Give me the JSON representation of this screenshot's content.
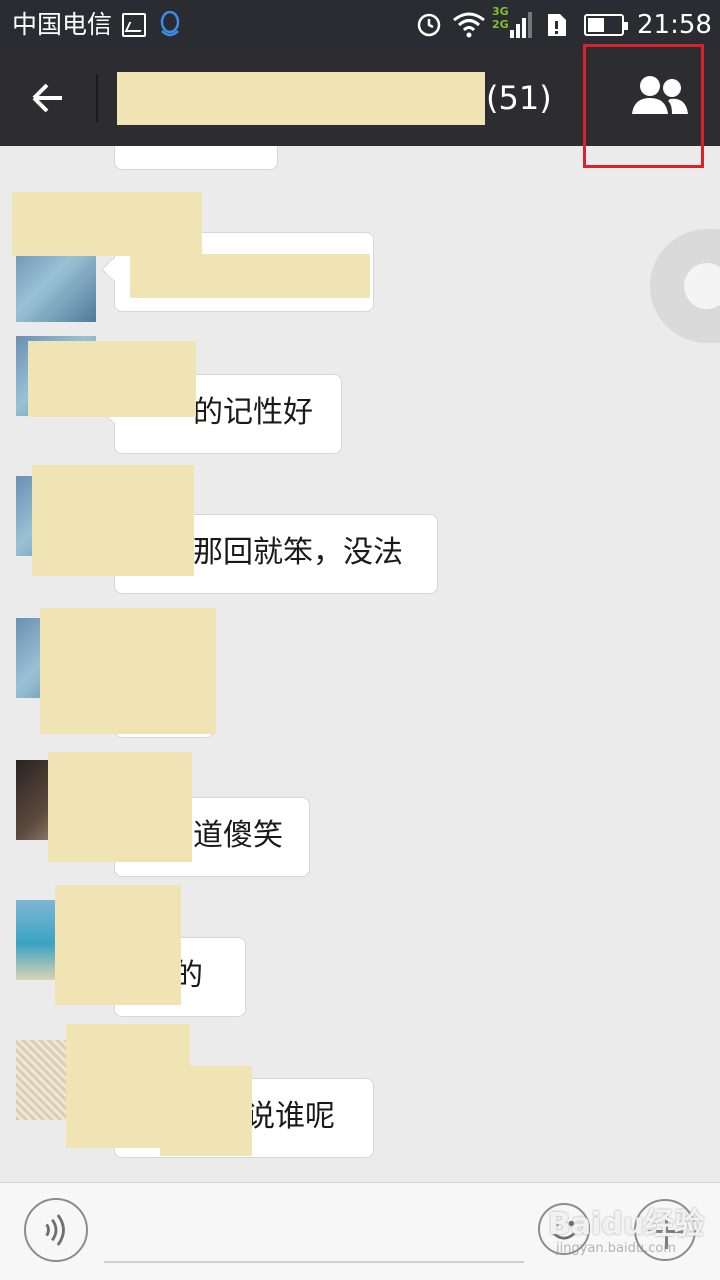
{
  "status_bar": {
    "carrier": "中国电信",
    "network_badge_top": "3G",
    "network_badge_bottom": "2G",
    "time": "21:58",
    "icons": [
      "image-icon",
      "qq-icon",
      "alarm-icon",
      "wifi-icon",
      "signal-icon",
      "sim-icon",
      "battery-icon"
    ],
    "battery_level": 0.4
  },
  "title_bar": {
    "back_icon": "arrow-left-icon",
    "member_count": "(51)",
    "members_icon": "group-members-icon",
    "highlight_color": "#d8232a"
  },
  "messages": [
    {
      "text": ""
    },
    {
      "text": ""
    },
    {
      "text": "的记性好"
    },
    {
      "text": "那回就笨，没法"
    },
    {
      "text": ""
    },
    {
      "text": "道傻笑"
    },
    {
      "text": "的"
    },
    {
      "text": "说谁呢"
    }
  ],
  "input_bar": {
    "voice_icon": "voice-icon",
    "emoji_icon": "emoji-icon",
    "plus_icon": "plus-icon"
  },
  "watermark": {
    "text": "Baidu经验",
    "sub": "jingyan.baidu.com"
  },
  "colors": {
    "header_bg": "#2c2c31",
    "status_bg": "#2b2b32",
    "chat_bg": "#ebebeb",
    "redaction": "#f0e4b4"
  }
}
